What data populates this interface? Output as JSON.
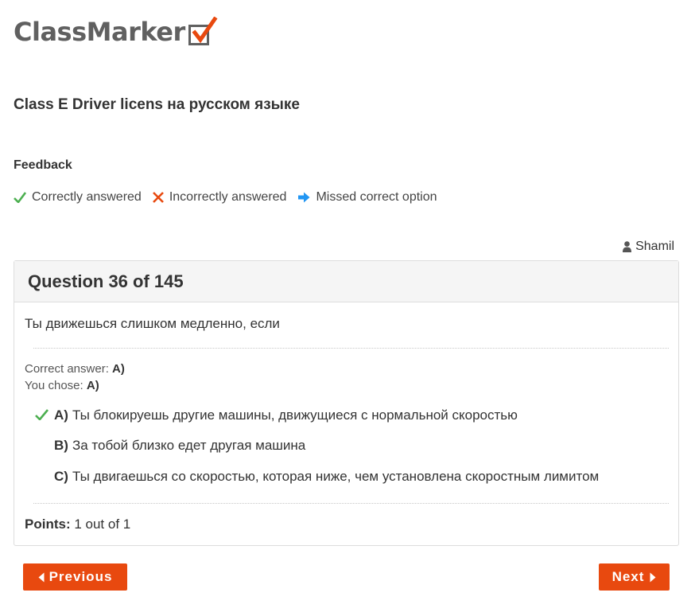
{
  "brand": {
    "name": "ClassMarker",
    "accent_color": "#e8490f",
    "text_color": "#606060"
  },
  "quiz_title": "Class E Driver licens на русском языке",
  "feedback": {
    "title": "Feedback",
    "legend": [
      {
        "icon": "check-icon",
        "label": "Correctly answered",
        "color": "#4caf50"
      },
      {
        "icon": "cross-icon",
        "label": "Incorrectly answered",
        "color": "#e8490f"
      },
      {
        "icon": "arrow-right-icon",
        "label": "Missed correct option",
        "color": "#2196f3"
      }
    ]
  },
  "user": {
    "icon": "user-icon",
    "name": "Shamil"
  },
  "question": {
    "header": "Question 36 of 145",
    "text": "Ты движешься слишком медленно, если",
    "correct_answer_label": "Correct answer:",
    "correct_answer_value": "A)",
    "you_chose_label": "You chose:",
    "you_chose_value": "A)",
    "options": [
      {
        "letter": "A)",
        "text": "Ты блокируешь другие машины, движущиеся с нормальной скоростью",
        "marker": "check-icon"
      },
      {
        "letter": "B)",
        "text": "За тобой близко едет другая машина",
        "marker": ""
      },
      {
        "letter": "C)",
        "text": "Ты двигаешься со скоростью, которая ниже, чем установлена скоростным лимитом",
        "marker": ""
      }
    ],
    "points_label": "Points:",
    "points_value": "1 out of 1"
  },
  "nav": {
    "previous_label": "Previous",
    "next_label": "Next"
  }
}
